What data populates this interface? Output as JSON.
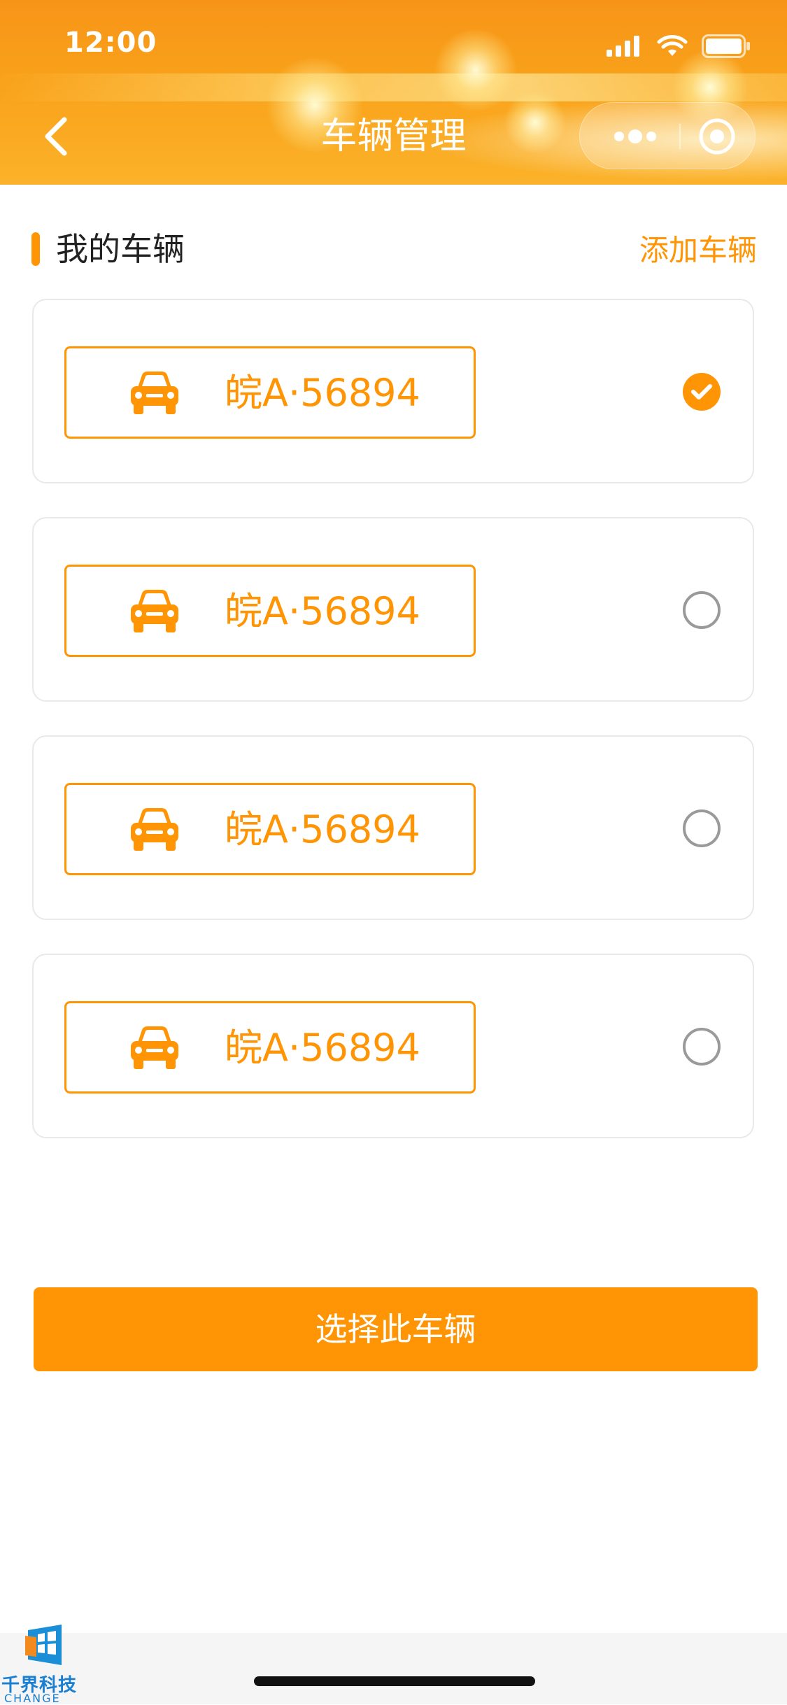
{
  "status_bar": {
    "time": "12:00"
  },
  "nav": {
    "title": "车辆管理"
  },
  "section": {
    "title": "我的车辆",
    "add_label": "添加车辆"
  },
  "vehicles": [
    {
      "plate": "皖A·56894",
      "selected": true
    },
    {
      "plate": "皖A·56894",
      "selected": false
    },
    {
      "plate": "皖A·56894",
      "selected": false
    },
    {
      "plate": "皖A·56894",
      "selected": false
    }
  ],
  "action": {
    "select_label": "选择此车辆"
  },
  "logo": {
    "name": "千界科技",
    "sub": "CHANGE"
  },
  "colors": {
    "accent": "#ff9505",
    "header_top": "#f79418",
    "radio_off": "#9a9a9a"
  },
  "icons": [
    "back-icon",
    "signal-icon",
    "wifi-icon",
    "battery-icon",
    "more-icon",
    "target-icon",
    "car-icon",
    "check-icon"
  ]
}
